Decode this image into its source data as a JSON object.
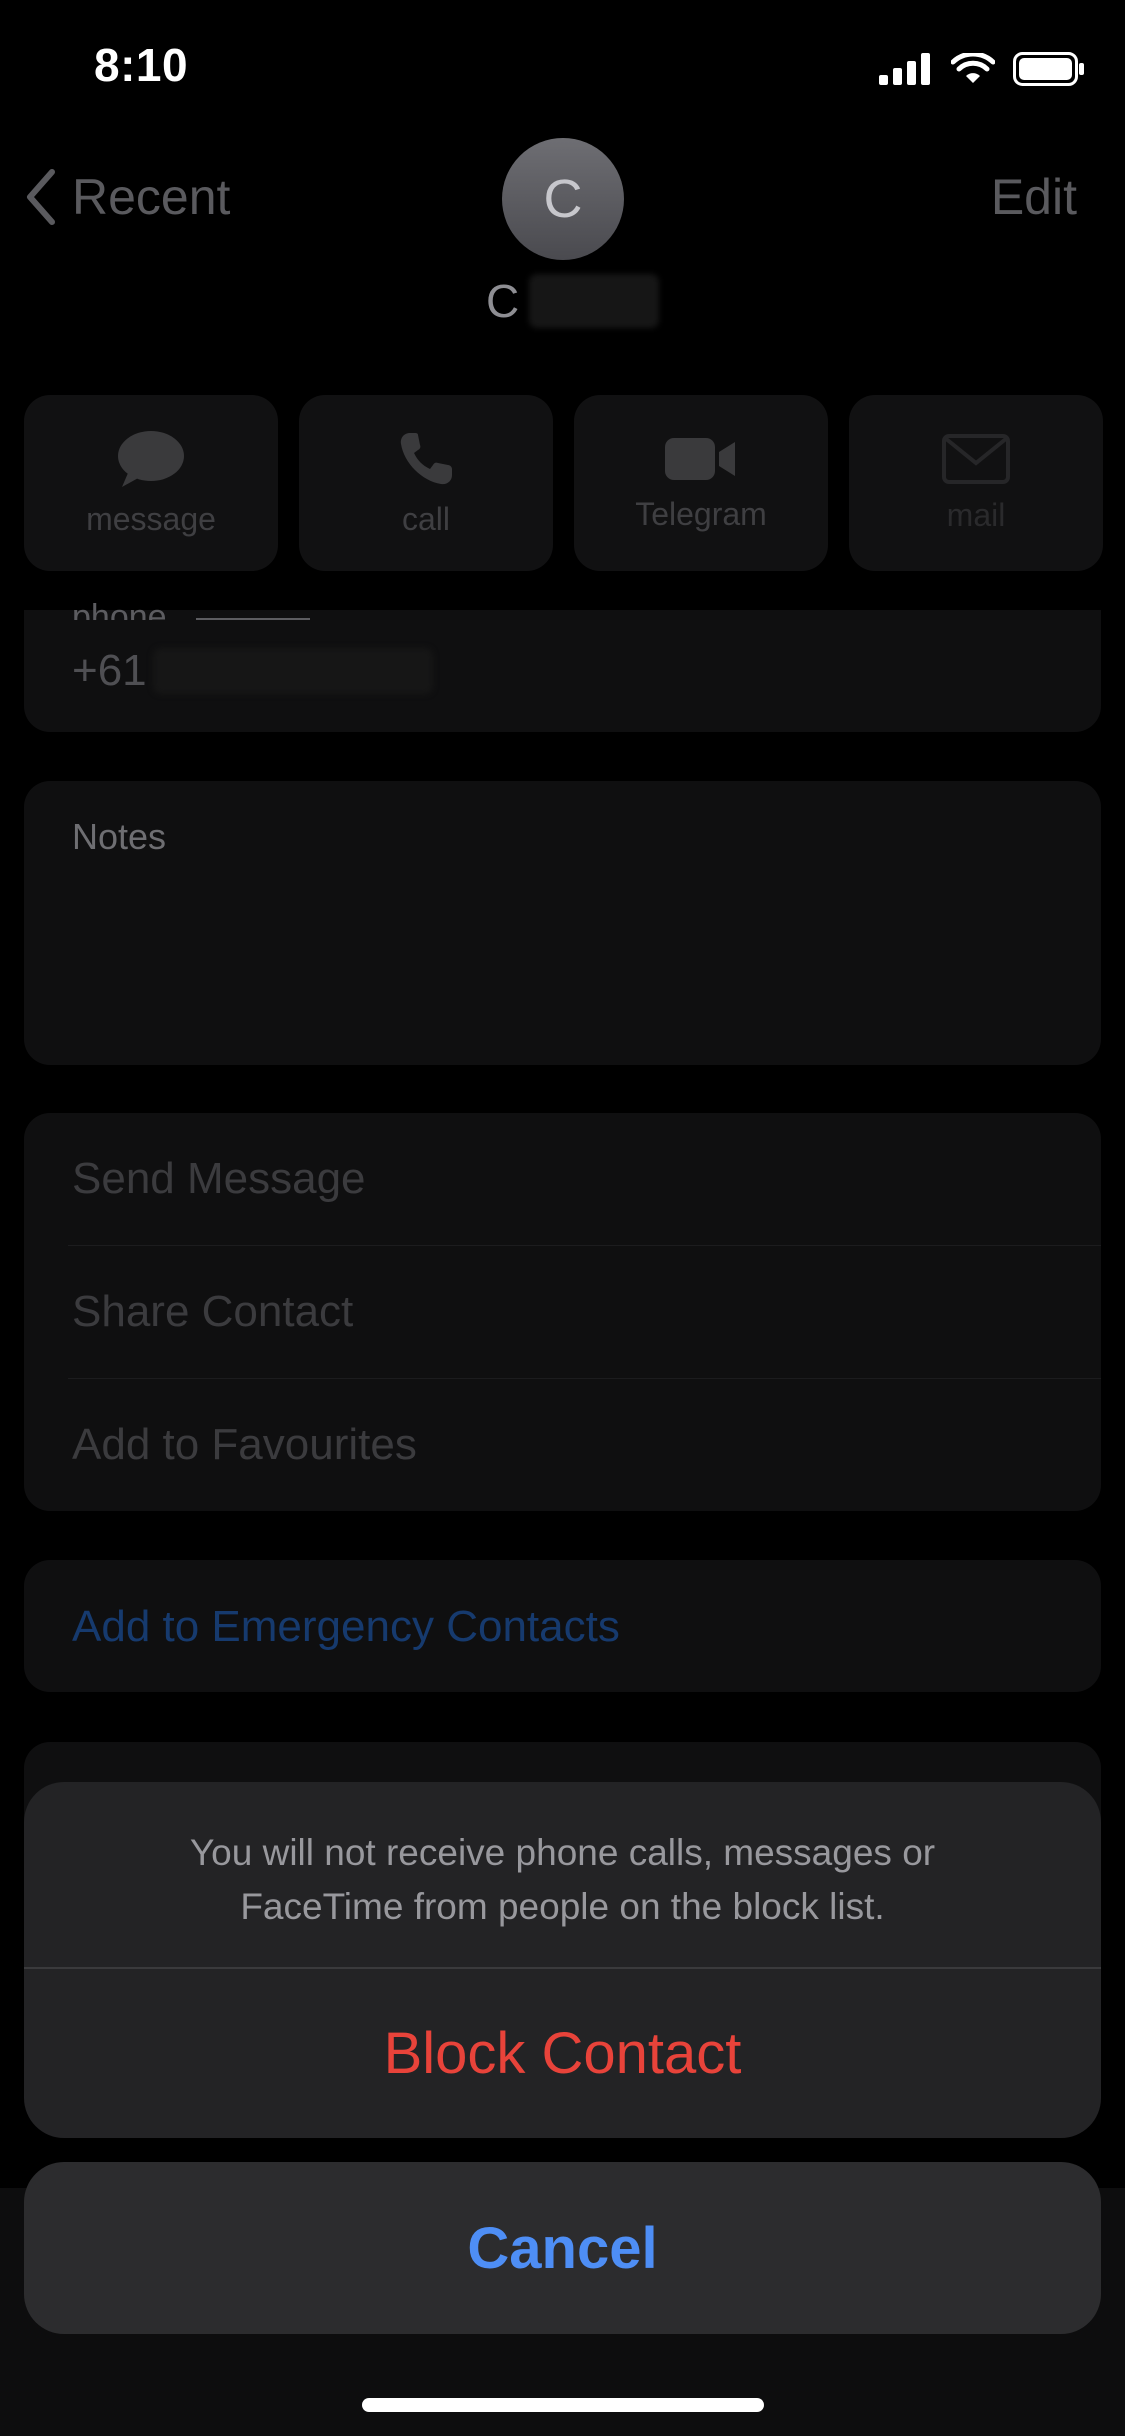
{
  "status_bar": {
    "time": "8:10",
    "icons": [
      "cellular-signal-icon",
      "wifi-icon",
      "battery-icon"
    ]
  },
  "nav": {
    "back_label": "Recent",
    "edit_label": "Edit"
  },
  "contact": {
    "avatar_initial": "C",
    "name_visible": "C"
  },
  "actions": [
    {
      "label": "message",
      "icon": "message-bubble-icon"
    },
    {
      "label": "call",
      "icon": "phone-icon"
    },
    {
      "label": "Telegram",
      "icon": "video-camera-icon"
    },
    {
      "label": "mail",
      "icon": "envelope-icon"
    }
  ],
  "phone_card": {
    "label": "phone",
    "number_visible": "+61"
  },
  "notes": {
    "label": "Notes"
  },
  "options": {
    "send_message": "Send Message",
    "share_contact": "Share Contact",
    "add_favourites": "Add to Favourites"
  },
  "emergency": {
    "label": "Add to Emergency Contacts"
  },
  "action_sheet": {
    "message_line1": "You will not receive phone calls, messages or",
    "message_line2": "FaceTime from people on the block list.",
    "block_label": "Block Contact",
    "cancel_label": "Cancel"
  },
  "colors": {
    "destructive": "#e8433a",
    "accent": "#4e8ef5",
    "link_dimmed": "#163a6e"
  }
}
